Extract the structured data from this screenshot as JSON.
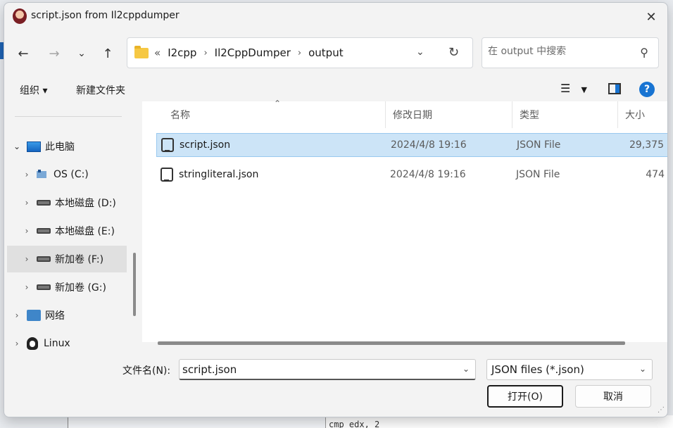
{
  "window": {
    "title": "script.json from Il2cppdumper"
  },
  "address_bar": {
    "overflow": "«",
    "crumbs": [
      "I2cpp",
      "Il2CppDumper",
      "output"
    ]
  },
  "search": {
    "placeholder": "在 output 中搜索"
  },
  "toolbar": {
    "organize": "组织 ▾",
    "new_folder": "新建文件夹"
  },
  "tree": [
    {
      "label": "此电脑",
      "icon": "pc-icon",
      "expanded": true
    },
    {
      "label": "OS (C:)",
      "icon": "os-drive-icon"
    },
    {
      "label": "本地磁盘 (D:)",
      "icon": "drive-icon"
    },
    {
      "label": "本地磁盘 (E:)",
      "icon": "drive-icon"
    },
    {
      "label": "新加卷 (F:)",
      "icon": "drive-icon",
      "selected": true
    },
    {
      "label": "新加卷 (G:)",
      "icon": "drive-icon"
    },
    {
      "label": "网络",
      "icon": "network-icon"
    },
    {
      "label": "Linux",
      "icon": "linux-icon"
    }
  ],
  "columns": {
    "name": "名称",
    "modified": "修改日期",
    "type": "类型",
    "size": "大小"
  },
  "files": [
    {
      "name": "script.json",
      "modified": "2024/4/8 19:16",
      "type": "JSON File",
      "size": "29,375",
      "selected": true
    },
    {
      "name": "stringliteral.json",
      "modified": "2024/4/8 19:16",
      "type": "JSON File",
      "size": "474"
    }
  ],
  "filename": {
    "label": "文件名(N):",
    "value": "script.json"
  },
  "filter": {
    "selected": "JSON files (*.json)"
  },
  "buttons": {
    "open": "打开(O)",
    "cancel": "取消"
  },
  "background": {
    "code_snippet": "cmp    edx, 2"
  },
  "colors": {
    "selection": "#cce4f7",
    "accent": "#1874d2",
    "folder": "#f6c843"
  }
}
